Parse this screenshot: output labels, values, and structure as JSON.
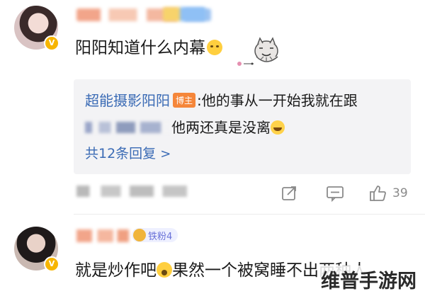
{
  "comment_1": {
    "text": "阳阳知道什么内幕",
    "emoji": "smile-emoji",
    "sticker": "cat-sticker"
  },
  "reply_preview": {
    "author": "超能摄影阳阳",
    "author_tag": "博主",
    "line1_text": ":他的事从一开始我就在跟",
    "line2_text": "他两还真是没离",
    "reply_count_label": "共12条回复"
  },
  "actions": {
    "share_icon": "share-icon",
    "comment_icon": "comment-icon",
    "like_icon": "like-icon",
    "like_count": "39"
  },
  "comment_2": {
    "fan_badge": "铁粉4",
    "text_before": "就是炒作吧",
    "text_after": "果然一个被窝睡不出两种人"
  },
  "watermark": "维普手游网",
  "colors": {
    "link_blue": "#3b6bb5",
    "author_tag_orange": "#f5863a",
    "verified_badge": "#f7b500",
    "reply_bg": "#f3f3f5",
    "icon_gray": "#8a8a8a"
  }
}
